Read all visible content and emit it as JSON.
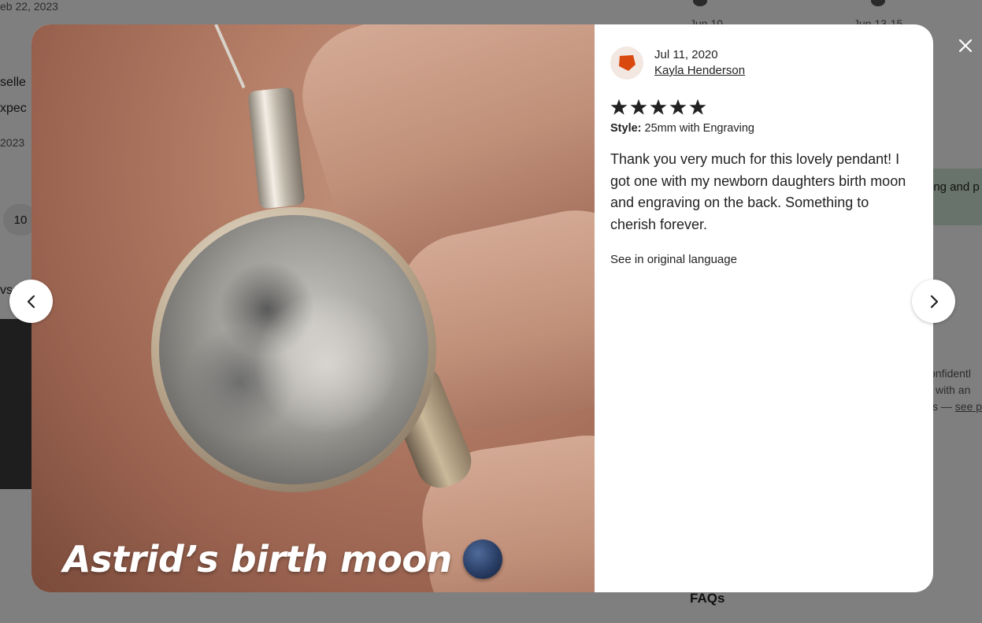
{
  "background": {
    "date_top": "eb 22, 2023",
    "text_seller": "selle",
    "text_expect": "xpec",
    "year": "2023",
    "page_chip": "10",
    "letter_vs": "vs",
    "header_right_1": "Jun 10",
    "header_right_2": "Jun 13-15",
    "green_banner": "ing and p",
    "right_line_1": "onfidentl",
    "right_line_2": "with an",
    "right_line_3_prefix": "s — ",
    "right_line_3_link": "see p",
    "faqs": "FAQs"
  },
  "modal": {
    "photo_caption": "Astrid’s birth moon",
    "review": {
      "date": "Jul 11, 2020",
      "reviewer_name": "Kayla Henderson",
      "rating": 5,
      "style_label": "Style:",
      "style_value": "25mm with Engraving",
      "body": "Thank you very much for this lovely pendant! I got one with my newborn daughters birth moon and engraving on the back. Something to cherish forever.",
      "see_original": "See in original language"
    }
  },
  "colors": {
    "avatar_shape": "#d9480f",
    "avatar_bg": "#f3e7e1",
    "star": "#222222",
    "overlay": "rgba(0,0,0,0.5)"
  },
  "icons": {
    "prev": "chevron-left-icon",
    "next": "chevron-right-icon",
    "close": "close-icon",
    "star": "star-icon",
    "avatar": "pentagon-avatar-icon"
  }
}
